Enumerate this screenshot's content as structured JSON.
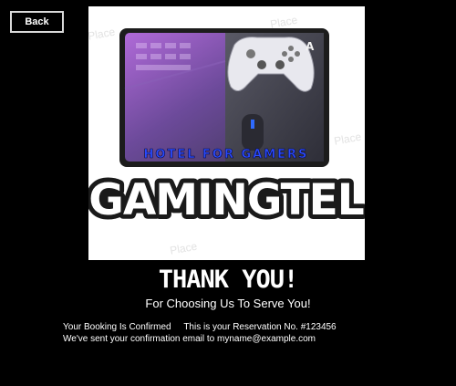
{
  "header": {
    "back_label": "Back"
  },
  "logo": {
    "tagline": "HOTEL FOR GAMERS",
    "name": "GAMINGTEL",
    "watermark": "Place"
  },
  "message": {
    "title": "THANK YOU!",
    "subtitle": "For Choosing Us To Serve You!",
    "booking_status": "Your Booking Is Confirmed",
    "reservation_text": "This is your Reservation No. #123456",
    "email_text": "We've sent your confirmation email to myname@example.com"
  },
  "colors": {
    "background": "#000000",
    "text": "#ffffff",
    "tagline_blue": "#2a4bff",
    "button_border": "#d9d9d9"
  }
}
